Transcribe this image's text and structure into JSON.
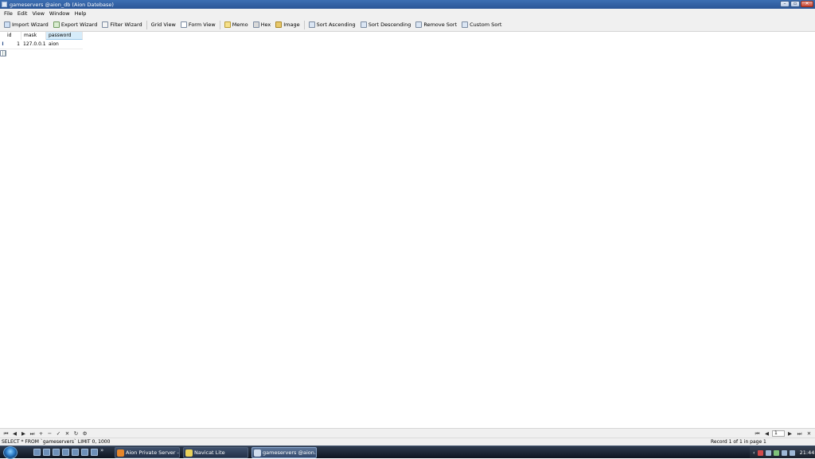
{
  "window": {
    "title": "gameservers @aion_db (Aion Datebase)"
  },
  "menu": [
    "File",
    "Edit",
    "View",
    "Window",
    "Help"
  ],
  "toolbar": {
    "import_wizard": "Import Wizard",
    "export_wizard": "Export Wizard",
    "filter_wizard": "Filter Wizard",
    "grid_view": "Grid View",
    "form_view": "Form View",
    "memo": "Memo",
    "hex": "Hex",
    "image": "Image",
    "sort_ascending": "Sort Ascending",
    "sort_descending": "Sort Descending",
    "remove_sort": "Remove Sort",
    "custom_sort": "Custom Sort"
  },
  "grid": {
    "columns": [
      "id",
      "mask",
      "password"
    ],
    "rows": [
      {
        "id": "1",
        "mask": "127.0.0.1",
        "password": "aion"
      }
    ],
    "row_indicator": "I"
  },
  "navigator": {
    "buttons": [
      "⏮",
      "◀",
      "▶",
      "⏭",
      "+",
      "−",
      "✓",
      "✕",
      "↻",
      "⚙"
    ],
    "page": "1"
  },
  "status": {
    "sql": "SELECT * FROM `gameservers` LIMIT 0, 1000",
    "record": "Record 1 of 1 in page 1"
  },
  "taskbar": {
    "quicklaunch_more": "»",
    "tasks": [
      {
        "label": "Aion Private Server -...",
        "active": false
      },
      {
        "label": "Navicat Lite",
        "active": false
      },
      {
        "label": "gameservers @aion...",
        "active": true
      }
    ],
    "clock": "21:44"
  }
}
